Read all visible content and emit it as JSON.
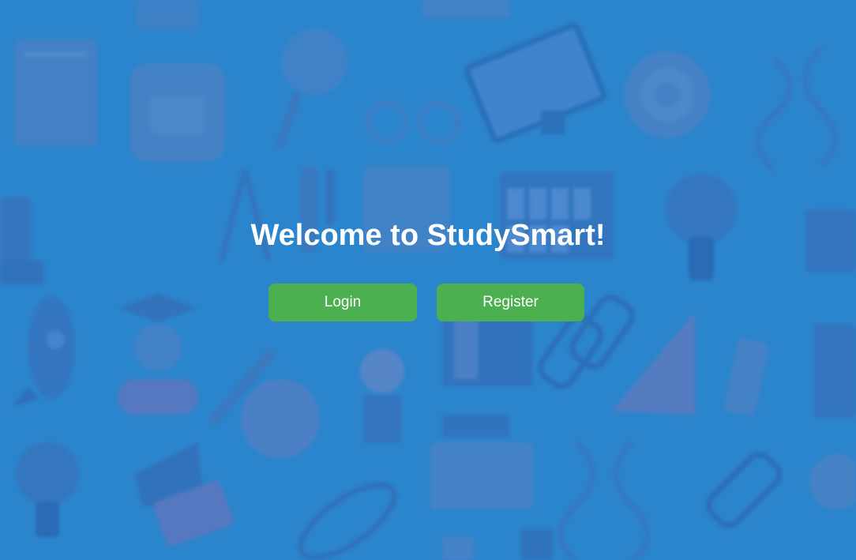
{
  "page": {
    "title": "Welcome to StudySmart!"
  },
  "actions": {
    "login_label": "Login",
    "register_label": "Register"
  },
  "colors": {
    "background": "#2f87cc",
    "button": "#4caf50",
    "text": "#ffffff"
  },
  "background_icons": [
    "notebook-icon",
    "backpack-icon",
    "magnifier-icon",
    "glasses-icon",
    "computer-monitor-icon",
    "target-icon",
    "dna-icon",
    "microscope-icon",
    "compass-icon",
    "test-tube-icon",
    "calendar-icon",
    "lightbulb-icon",
    "rocket-icon",
    "graduate-icon",
    "pencil-icon",
    "globe-icon",
    "ruler-icon",
    "palette-icon",
    "award-icon",
    "megaphone-icon",
    "atom-icon",
    "printer-icon",
    "book-icon"
  ]
}
